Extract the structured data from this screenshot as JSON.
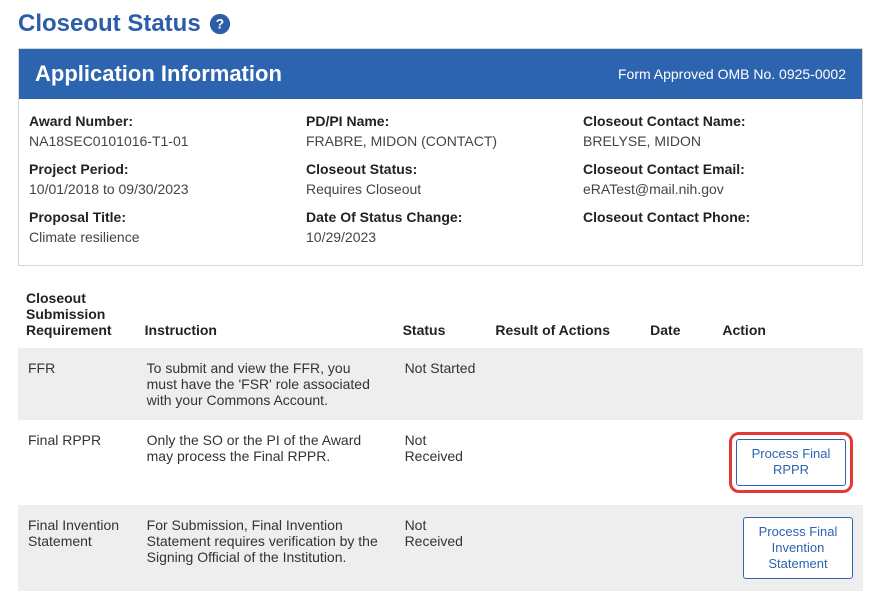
{
  "page_title": "Closeout Status",
  "panel": {
    "title": "Application Information",
    "form_approved": "Form Approved OMB No. 0925-0002"
  },
  "info": {
    "award_number": {
      "label": "Award Number:",
      "value": "NA18SEC0101016-T1-01"
    },
    "project_period": {
      "label": "Project Period:",
      "value": "10/01/2018 to 09/30/2023"
    },
    "proposal_title": {
      "label": "Proposal Title:",
      "value": "Climate resilience"
    },
    "pdpi_name": {
      "label": "PD/PI Name:",
      "value": "FRABRE, MIDON (CONTACT)"
    },
    "closeout_status": {
      "label": "Closeout Status:",
      "value": "Requires Closeout"
    },
    "status_change_date": {
      "label": "Date Of Status Change:",
      "value": "10/29/2023"
    },
    "contact_name": {
      "label": "Closeout Contact Name:",
      "value": "BRELYSE, MIDON"
    },
    "contact_email": {
      "label": "Closeout Contact Email:",
      "value": "eRATest@mail.nih.gov"
    },
    "contact_phone": {
      "label": "Closeout Contact Phone:",
      "value": ""
    }
  },
  "table": {
    "headers": {
      "requirement": "Closeout Submission Requirement",
      "instruction": "Instruction",
      "status": "Status",
      "result": "Result of Actions",
      "date": "Date",
      "action": "Action"
    },
    "rows": [
      {
        "requirement": "FFR",
        "instruction": "To submit and view the FFR, you must have the 'FSR' role associated with your Commons Account.",
        "status": "Not Started",
        "result": "",
        "date": "",
        "action": null
      },
      {
        "requirement": "Final RPPR",
        "instruction": "Only the SO or the PI of the Award may process the Final RPPR.",
        "status": "Not Received",
        "result": "",
        "date": "",
        "action": "Process Final RPPR",
        "highlight": true
      },
      {
        "requirement": "Final Invention Statement",
        "instruction": "For Submission, Final Invention Statement requires verification by the Signing Official of the Institution.",
        "status": "Not Received",
        "result": "",
        "date": "",
        "action": "Process Final Invention Statement"
      }
    ]
  }
}
